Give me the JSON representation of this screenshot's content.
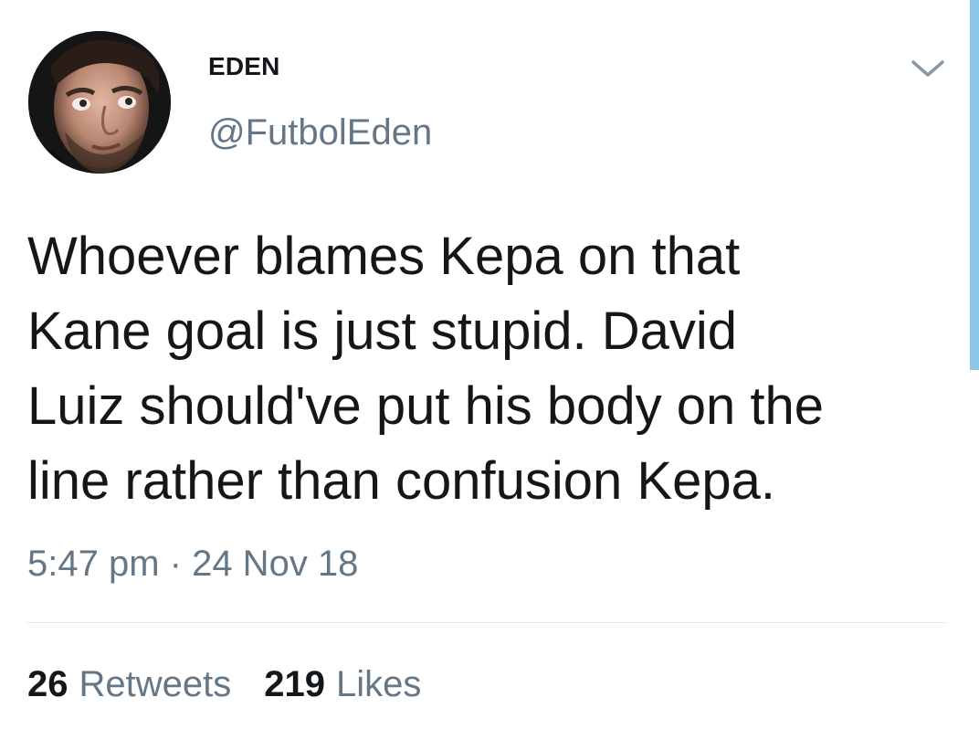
{
  "tweet": {
    "author": {
      "display_name": "EDEN",
      "handle": "@FutbolEden",
      "avatar_icon": "profile-photo"
    },
    "text": "Whoever blames Kepa on that\nKane goal is just stupid. David\nLuiz should've put his body on the\nline rather than confusion Kepa.",
    "timestamp": "5:47 pm · 24 Nov 18",
    "stats": {
      "retweets_count": "26",
      "retweets_label": "Retweets",
      "likes_count": "219",
      "likes_label": "Likes"
    }
  },
  "colors": {
    "text_primary": "#14171a",
    "text_secondary": "#657786",
    "divider": "#e1e8ed",
    "scrollbar": "#90c5ec"
  }
}
